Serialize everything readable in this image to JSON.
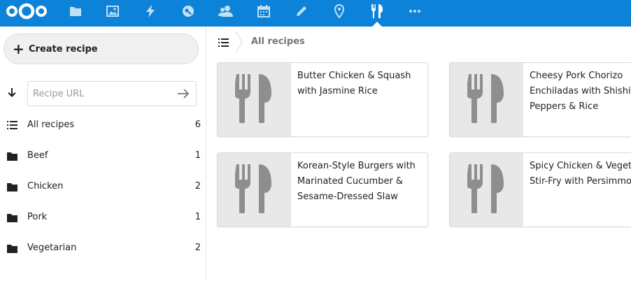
{
  "header": {
    "logo": "nextcloud-logo",
    "apps": [
      {
        "name": "files-icon"
      },
      {
        "name": "photos-icon"
      },
      {
        "name": "activity-icon"
      },
      {
        "name": "passwords-icon"
      },
      {
        "name": "contacts-icon"
      },
      {
        "name": "calendar-icon"
      },
      {
        "name": "notes-icon"
      },
      {
        "name": "maps-icon"
      },
      {
        "name": "cookbook-icon",
        "active": true
      },
      {
        "name": "more-apps-icon"
      }
    ],
    "colors": {
      "background": "#0c83d8",
      "icon": "#ffffff"
    }
  },
  "sidebar": {
    "create_label": "Create recipe",
    "url_placeholder": "Recipe URL",
    "items": [
      {
        "label": "All recipes",
        "count": "6",
        "icon": "list-icon"
      },
      {
        "label": "Beef",
        "count": "1",
        "icon": "folder-icon"
      },
      {
        "label": "Chicken",
        "count": "2",
        "icon": "folder-icon"
      },
      {
        "label": "Pork",
        "count": "1",
        "icon": "folder-icon"
      },
      {
        "label": "Vegetarian",
        "count": "2",
        "icon": "folder-icon"
      }
    ]
  },
  "breadcrumb": {
    "current": "All recipes"
  },
  "recipes": [
    {
      "title": "Butter Chicken & Squash with Jasmine Rice"
    },
    {
      "title": "Cheesy Pork Chorizo Enchiladas with Shishito Peppers & Rice"
    },
    {
      "title": "Korean-Style Burgers with Marinated Cucumber & Sesame-Dressed Slaw"
    },
    {
      "title": "Spicy Chicken & Vegetable Stir-Fry with Persimmon"
    }
  ]
}
